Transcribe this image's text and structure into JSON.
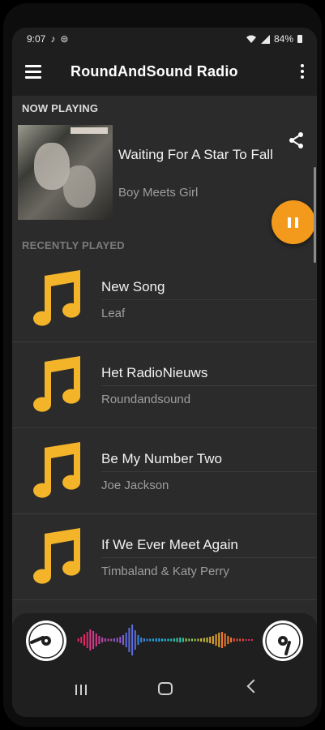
{
  "status": {
    "time": "9:07",
    "battery": "84%"
  },
  "appbar": {
    "title": "RoundAndSound Radio"
  },
  "now_playing": {
    "header": "NOW PLAYING",
    "title": "Waiting For A Star To Fall",
    "artist": "Boy Meets Girl"
  },
  "recent": {
    "header": "RECENTLY PLAYED",
    "items": [
      {
        "title": "New Song",
        "artist": "Leaf"
      },
      {
        "title": "Het RadioNieuws",
        "artist": "Roundandsound"
      },
      {
        "title": "Be My Number Two",
        "artist": "Joe Jackson"
      },
      {
        "title": "If We Ever Meet Again",
        "artist": "Timbaland & Katy Perry"
      }
    ]
  },
  "colors": {
    "accent": "#f39a1c",
    "note": "#f4b42a",
    "header_text": "#dcdcdc",
    "muted_header": "#7a7a7a"
  },
  "icons": [
    "menu-icon",
    "more-vert-icon",
    "share-icon",
    "pause-icon",
    "music-note-icon",
    "vinyl-disc-icon",
    "nav-recents-icon",
    "nav-home-icon",
    "nav-back-icon"
  ]
}
